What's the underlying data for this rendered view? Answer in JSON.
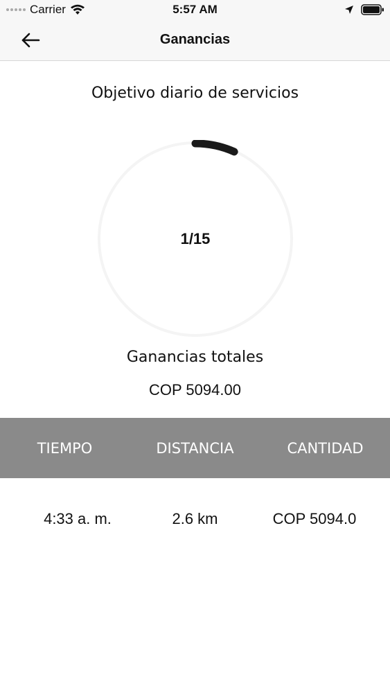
{
  "status_bar": {
    "carrier": "Carrier",
    "time": "5:57 AM",
    "icons": [
      "signal-dots-icon",
      "wifi-icon",
      "location-arrow-icon",
      "battery-icon"
    ]
  },
  "nav": {
    "title": "Ganancias",
    "back_icon": "arrow-left-icon"
  },
  "goal": {
    "label": "Objetivo diario de servicios",
    "progress_text": "1/15",
    "completed": 1,
    "target": 15
  },
  "earnings": {
    "label": "Ganancias totales",
    "value": "COP 5094.00"
  },
  "table": {
    "headers": [
      "TIEMPO",
      "DISTANCIA",
      "CANTIDAD"
    ],
    "rows": [
      [
        "4:33 a. m.",
        "2.6 km",
        "COP 5094.0"
      ]
    ]
  },
  "colors": {
    "header_bg": "#8a8a8a",
    "ring_progress": "#1a1a1a",
    "ring_track": "#f4f4f4",
    "bar_bg": "#f7f7f7"
  }
}
